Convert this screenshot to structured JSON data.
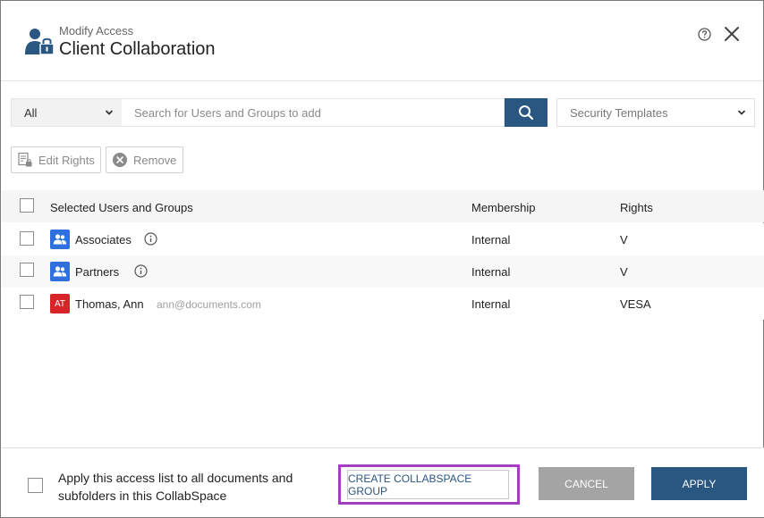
{
  "header": {
    "subtitle": "Modify Access",
    "title": "Client Collaboration",
    "icon": "user-lock-icon",
    "help_icon": "help-icon",
    "close_icon": "close-icon"
  },
  "search": {
    "scope_value": "All",
    "placeholder": "Search for Users and Groups to add",
    "templates_placeholder": "Security Templates"
  },
  "toolbar": {
    "edit_label": "Edit Rights",
    "remove_label": "Remove"
  },
  "table": {
    "columns": [
      "Selected Users and Groups",
      "Membership",
      "Rights"
    ],
    "rows": [
      {
        "name": "Associates",
        "type": "group",
        "membership": "Internal",
        "rights": "V"
      },
      {
        "name": "Partners",
        "type": "group",
        "membership": "Internal",
        "rights": "V"
      },
      {
        "name": "Thomas, Ann",
        "type": "user",
        "initials": "AT",
        "email": "ann@documents.com",
        "membership": "Internal",
        "rights": "VESA"
      }
    ]
  },
  "footer": {
    "apply_all_label": "Apply this access list to all documents and subfolders in this CollabSpace",
    "create_group_label": "CREATE COLLABSPACE GROUP",
    "cancel_label": "CANCEL",
    "apply_label": "APPLY"
  },
  "colors": {
    "primary": "#2a5682",
    "group_avatar": "#2f6fde",
    "user_avatar": "#d9252a",
    "highlight": "#a040c0",
    "cancel": "#a4a4a4"
  }
}
